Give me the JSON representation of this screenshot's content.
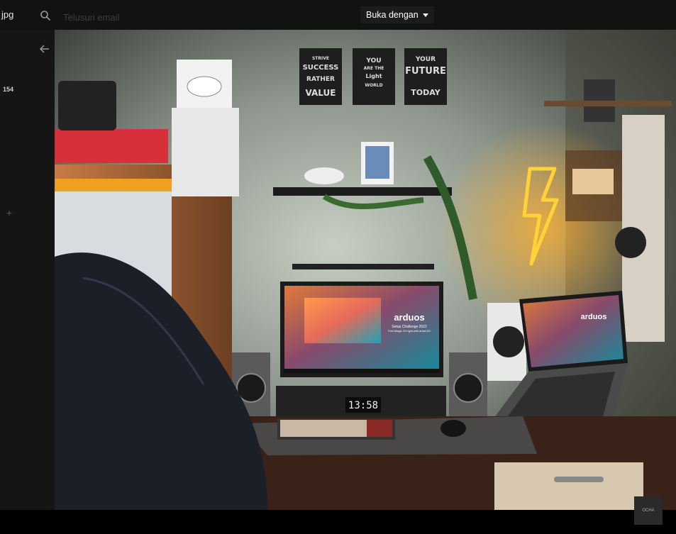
{
  "header": {
    "filename": "jpg",
    "search_placeholder": "Telusuri email",
    "open_with_label": "Buka dengan"
  },
  "sidebar": {
    "count": "154"
  },
  "photo": {
    "poster_1": [
      "STRIVE",
      "SUCCESS",
      "RATHER",
      "VALUE"
    ],
    "poster_2": [
      "YOU",
      "ARE THE",
      "Light",
      "WORLD"
    ],
    "poster_3": [
      "YOUR",
      "FUTURE",
      "TODAY"
    ],
    "brand": "arduos",
    "subtitle": "Setup Challenge 2022",
    "tagline": "Feel Magic Of Light with arduLED",
    "clock": "13:58"
  },
  "watermark": "OCHA"
}
